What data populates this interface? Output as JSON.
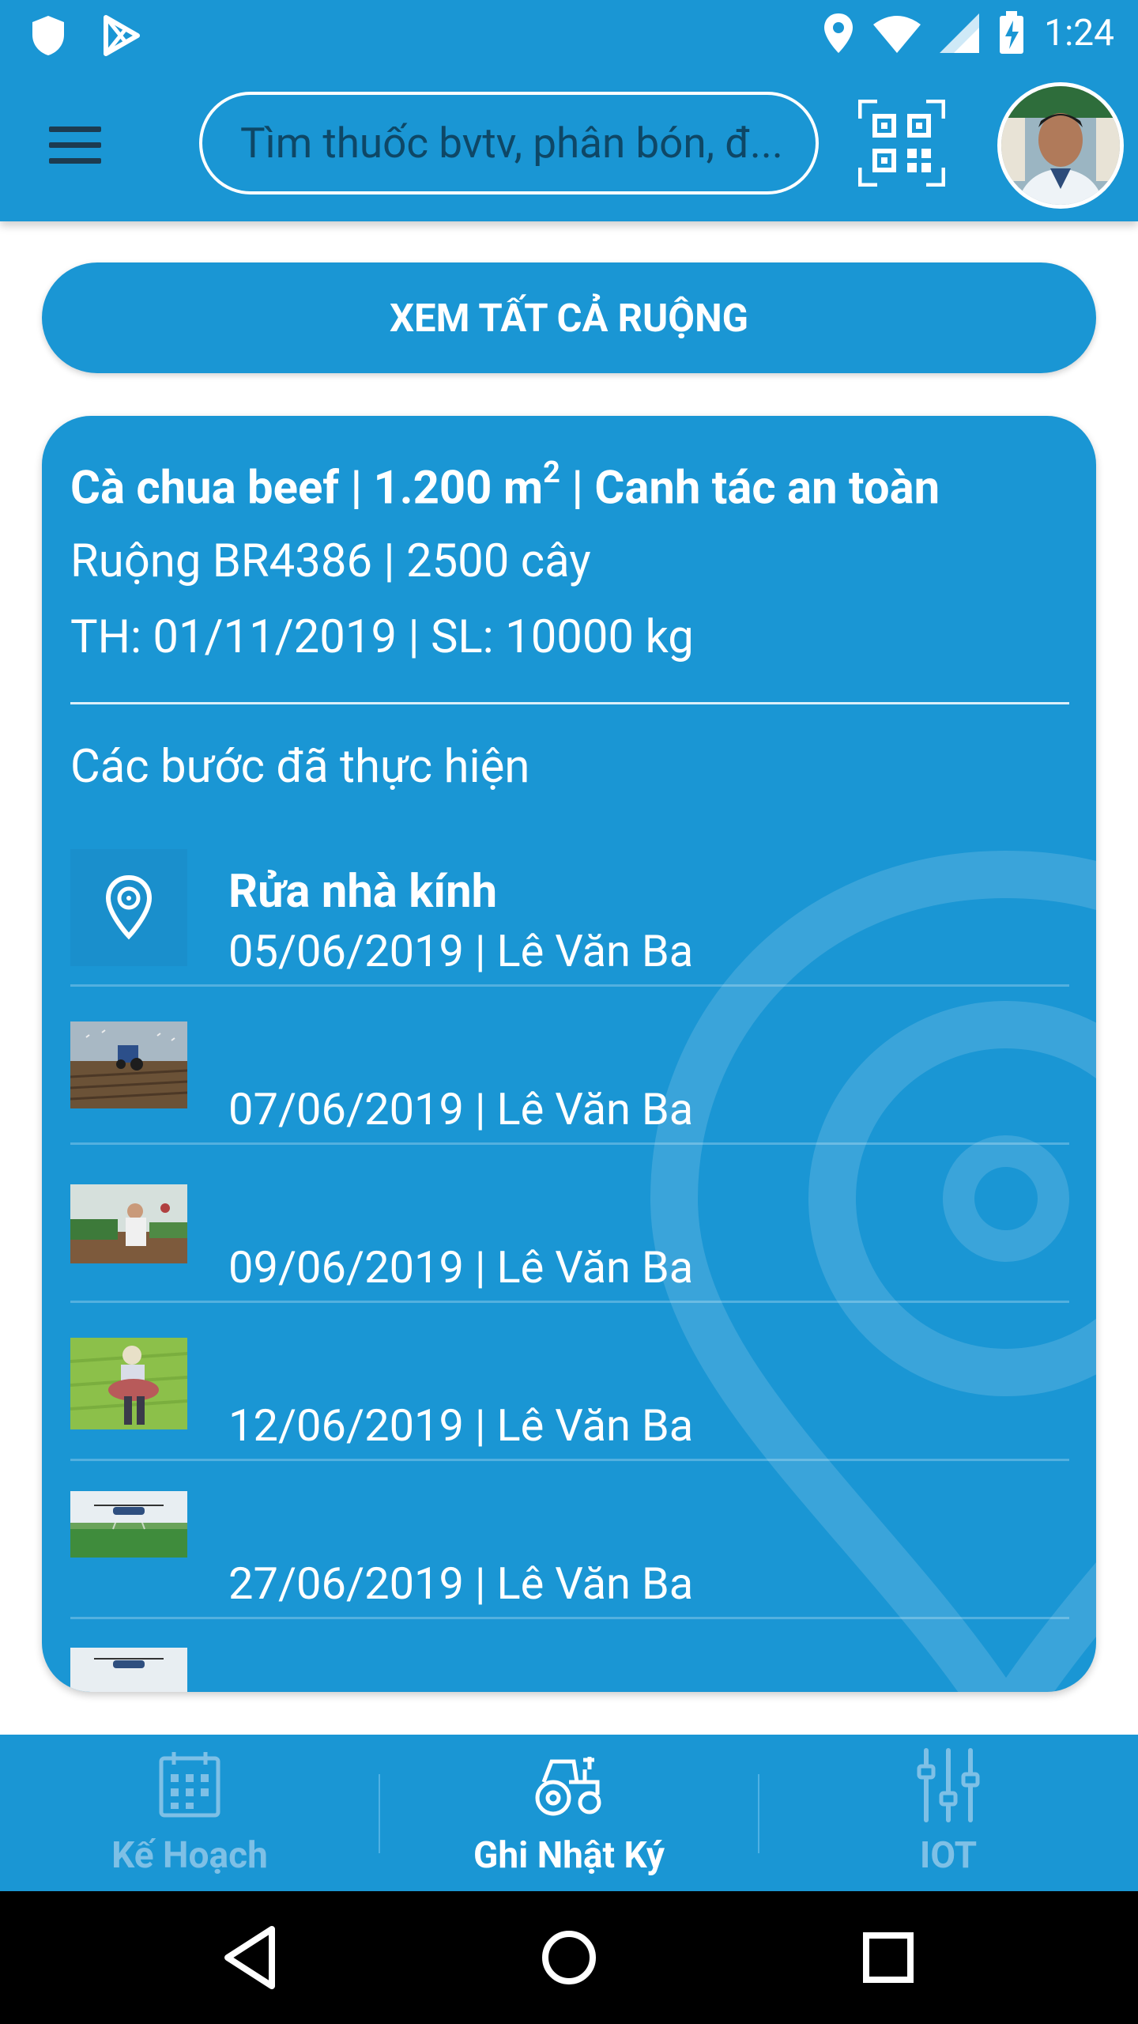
{
  "status_bar": {
    "time": "1:24"
  },
  "header": {
    "search_placeholder": "Tìm thuốc bvtv, phân bón, đ...",
    "qr_icon": "qr-scan-icon",
    "avatar_alt": "user avatar"
  },
  "view_all_label": "XEM TẤT CẢ RUỘNG",
  "field": {
    "title_prefix": "Cà chua beef | 1.200 m",
    "title_sup": "2",
    "title_suffix": " | Canh tác an toàn",
    "line2": "Ruộng BR4386 | 2500 cây",
    "line3": "TH: 01/11/2019 | SL: 10000 kg",
    "steps_heading": "Các bước đã thực hiện"
  },
  "steps": [
    {
      "title": "Rửa nhà kính",
      "meta": "05/06/2019 | Lê Văn Ba",
      "thumb": "location-icon"
    },
    {
      "title": "",
      "meta": "07/06/2019 | Lê Văn Ba",
      "thumb": "tractor-field-photo"
    },
    {
      "title": "",
      "meta": "09/06/2019 | Lê Văn Ba",
      "thumb": "greenhouse-worker-photo"
    },
    {
      "title": "",
      "meta": "12/06/2019 | Lê Văn Ba",
      "thumb": "farmer-spreading-photo"
    },
    {
      "title": "",
      "meta": "27/06/2019 | Lê Văn Ba",
      "thumb": "drone-spraying-photo"
    }
  ],
  "bottom_nav": {
    "tabs": [
      {
        "label": "Kế Hoạch",
        "icon": "calendar-icon",
        "active": false
      },
      {
        "label": "Ghi Nhật Ký",
        "icon": "tractor-icon",
        "active": true
      },
      {
        "label": "IOT",
        "icon": "sliders-icon",
        "active": false
      }
    ]
  },
  "colors": {
    "primary": "#1a96d4",
    "inactive_tab": "#7ec0e6",
    "placeholder": "#0e4766"
  }
}
